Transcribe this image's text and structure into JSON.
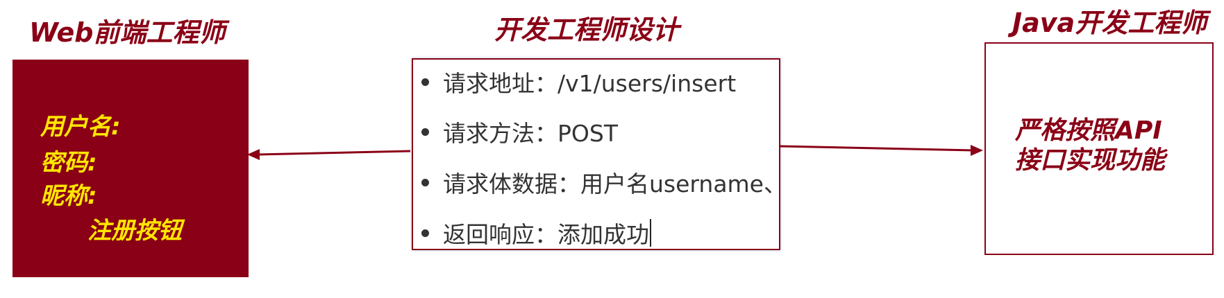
{
  "colors": {
    "dark_red": "#8a0016",
    "yellow": "#ffe600",
    "bullet_text": "#333333"
  },
  "headings": {
    "frontend": "Web前端工程师",
    "design": "开发工程师设计",
    "backend": "Java开发工程师"
  },
  "frontend_panel": {
    "lines": [
      "用户名:",
      "密码:",
      "昵称:",
      "注册按钮"
    ]
  },
  "api_spec": {
    "items": [
      "请求地址：/v1/users/insert",
      "请求方法：POST",
      "请求体数据：用户名username、",
      "返回响应：添加成功"
    ]
  },
  "backend_panel": {
    "lines": [
      "严格按照API",
      "接口实现功能"
    ]
  }
}
